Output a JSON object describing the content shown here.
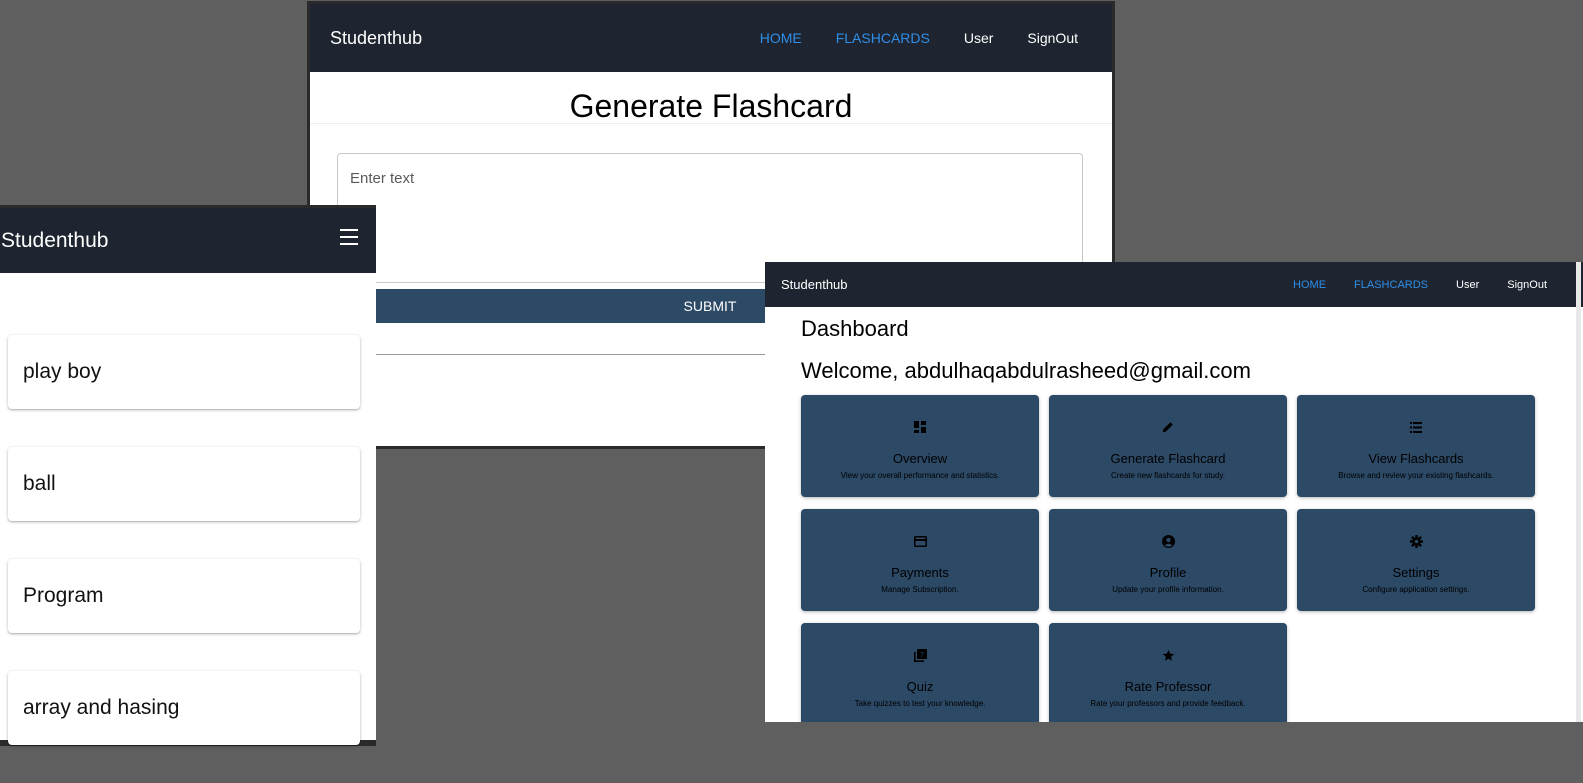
{
  "window_a": {
    "brand": "Studenthub",
    "nav": [
      "HOME",
      "FLASHCARDS",
      "User",
      "SignOut"
    ],
    "title": "Generate Flashcard",
    "input_placeholder": "Enter text",
    "submit_label": "SUBMIT"
  },
  "window_b": {
    "brand": "Studenthub",
    "flashcards": [
      "play boy",
      "ball",
      "Program",
      "array and hasing"
    ]
  },
  "window_c": {
    "brand": "Studenthub",
    "nav": [
      "HOME",
      "FLASHCARDS",
      "User",
      "SignOut"
    ],
    "title": "Dashboard",
    "welcome": "Welcome, abdulhaqabdulrasheed@gmail.com",
    "tiles": [
      {
        "icon": "dashboard-icon",
        "title": "Overview",
        "desc": "View your overall performance and statistics."
      },
      {
        "icon": "pencil-icon",
        "title": "Generate Flashcard",
        "desc": "Create new flashcards for study."
      },
      {
        "icon": "list-icon",
        "title": "View Flashcards",
        "desc": "Browse and review your existing flashcards."
      },
      {
        "icon": "credit-card-icon",
        "title": "Payments",
        "desc": "Manage Subscription."
      },
      {
        "icon": "account-circle-icon",
        "title": "Profile",
        "desc": "Update your profile information."
      },
      {
        "icon": "gear-icon",
        "title": "Settings",
        "desc": "Configure application settings."
      },
      {
        "icon": "quiz-icon",
        "title": "Quiz",
        "desc": "Take quizzes to test your knowledge."
      },
      {
        "icon": "star-icon",
        "title": "Rate Professor",
        "desc": "Rate your professors and provide feedback."
      }
    ]
  },
  "colors": {
    "navbar": "#1e2530",
    "accent_link": "#2f8ee8",
    "tile": "#2c4966",
    "backdrop": "#5f5f5f"
  }
}
